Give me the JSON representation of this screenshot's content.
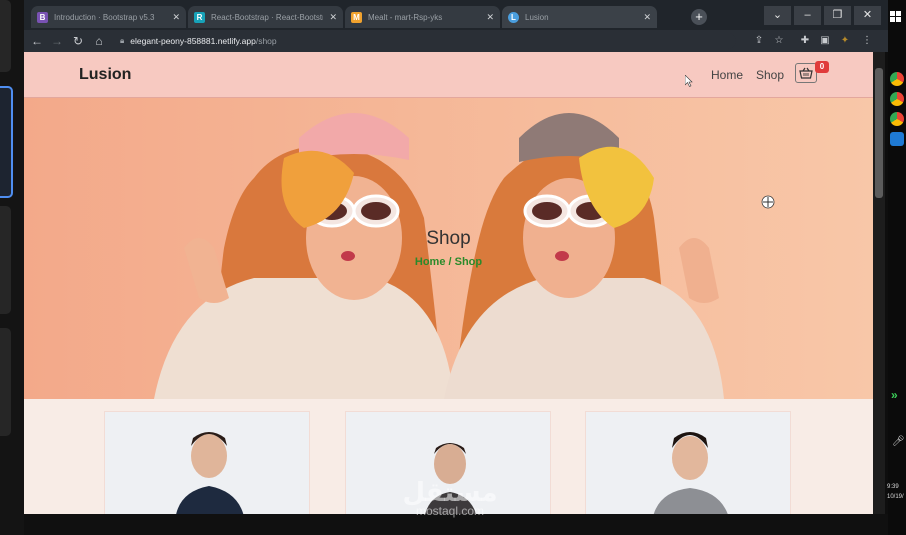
{
  "tabs": [
    {
      "title": "Introduction · Bootstrap v5.3",
      "favicon": "B",
      "favicon_color": "#7952b3"
    },
    {
      "title": "React-Bootstrap · React-Bootstrap",
      "favicon": "R",
      "favicon_color": "#17a2b8"
    },
    {
      "title": "Mealt - mart-Rsp-yks",
      "favicon": "M",
      "favicon_color": "#f0a22e"
    },
    {
      "title": "Lusion",
      "favicon": "L",
      "favicon_color": "#4a9ede"
    }
  ],
  "window_controls": {
    "chevron": "⌄",
    "minimize": "–",
    "restore": "❐",
    "close": "✕"
  },
  "url": {
    "host": "elegant-peony-858881.netlify.app",
    "path": "/shop"
  },
  "site": {
    "brand": "Lusion",
    "nav": [
      "Home",
      "Shop"
    ],
    "cart_count": "0"
  },
  "hero": {
    "title": "Shop",
    "crumb_home": "Home",
    "crumb_sep": " / ",
    "crumb_current": "Shop"
  },
  "watermark": {
    "arabic": "مستقل",
    "latin": "mostaql.com"
  },
  "taskbar": {
    "time": "9:39",
    "date": "10/19/"
  },
  "colors": {
    "accent_green": "#2a8a2a",
    "navbar_bg": "#f7c9c1",
    "badge_red": "#e03b3b",
    "hero_bg": "#f5b797"
  }
}
